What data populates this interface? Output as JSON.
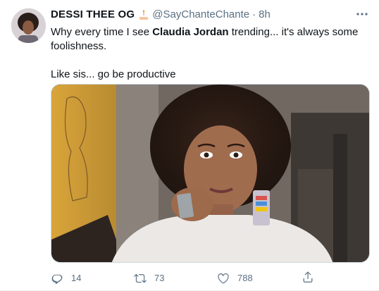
{
  "tweet": {
    "display_name": "DESSI THEE OG",
    "name_emoji": "birthday-cake-emoji",
    "handle": "@SayChanteChante",
    "separator": "·",
    "time": "8h",
    "more_icon": "more-horizontal-icon",
    "text_before": "Why every time I see ",
    "text_bold": "Claudia Jordan",
    "text_after": " trending... it's always some foolishness.",
    "text_line2": "Like sis... go be productive",
    "media_description_icon": "video-thumbnail",
    "actions": {
      "reply_count": "14",
      "retweet_count": "73",
      "like_count": "788"
    },
    "colors": {
      "primary_text": "#0f1419",
      "secondary_text": "#5b7083",
      "border": "#cfd9de"
    }
  }
}
